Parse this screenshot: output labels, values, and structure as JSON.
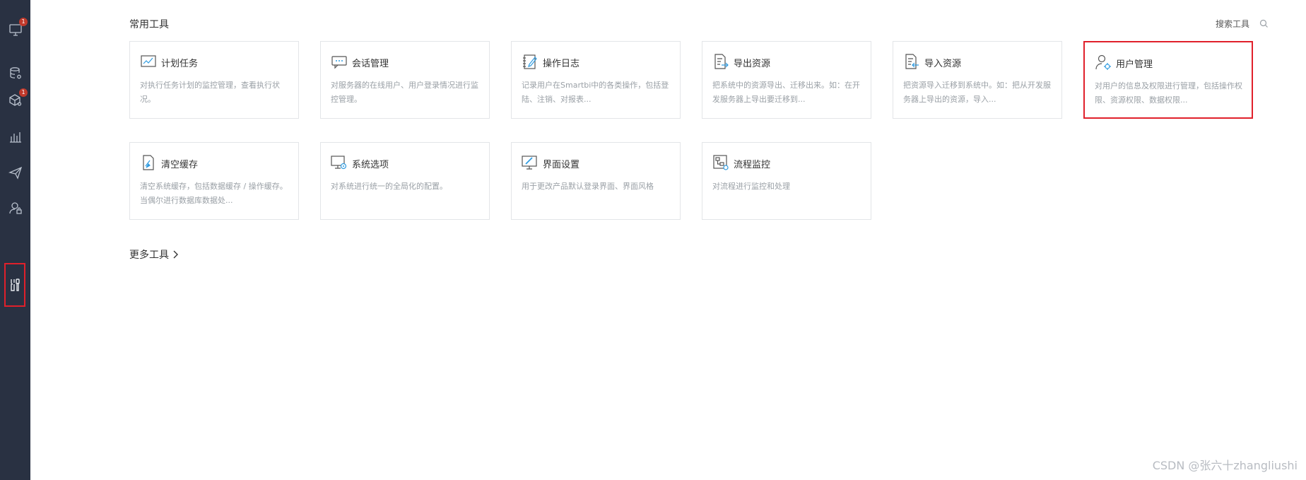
{
  "sidebar": {
    "items": [
      {
        "name": "monitor-icon",
        "badge": "1"
      },
      {
        "name": "database-settings-icon",
        "badge": ""
      },
      {
        "name": "cube-settings-icon",
        "badge": "1"
      },
      {
        "name": "bar-chart-icon",
        "badge": ""
      },
      {
        "name": "paper-plane-icon",
        "badge": ""
      },
      {
        "name": "user-lock-icon",
        "badge": ""
      },
      {
        "name": "tools-icon",
        "badge": ""
      }
    ]
  },
  "section": {
    "title": "常用工具",
    "search_label": "搜索工具"
  },
  "cards": [
    {
      "title": "计划任务",
      "desc": "对执行任务计划的监控管理，查看执行状况。"
    },
    {
      "title": "会话管理",
      "desc": "对服务器的在线用户、用户登录情况进行监控管理。"
    },
    {
      "title": "操作日志",
      "desc": "记录用户在Smartbi中的各类操作，包括登陆、注销、对报表..."
    },
    {
      "title": "导出资源",
      "desc": "把系统中的资源导出、迁移出来。如：在开发服务器上导出要迁移到..."
    },
    {
      "title": "导入资源",
      "desc": "把资源导入迁移到系统中。如：把从开发服务器上导出的资源，导入..."
    },
    {
      "title": "用户管理",
      "desc": "对用户的信息及权限进行管理，包括操作权限、资源权限、数据权限..."
    },
    {
      "title": "清空缓存",
      "desc": "清空系统缓存，包括数据缓存 / 操作缓存。当偶尔进行数据库数据处..."
    },
    {
      "title": "系统选项",
      "desc": "对系统进行统一的全局化的配置。"
    },
    {
      "title": "界面设置",
      "desc": "用于更改产品默认登录界面、界面风格"
    },
    {
      "title": "流程监控",
      "desc": "对流程进行监控和处理"
    }
  ],
  "more_tools_label": "更多工具",
  "watermark": "CSDN @张六十zhangliushi",
  "colors": {
    "sidebar_bg": "#293142",
    "highlight": "#e0202b",
    "accent_blue": "#2f9be0"
  }
}
